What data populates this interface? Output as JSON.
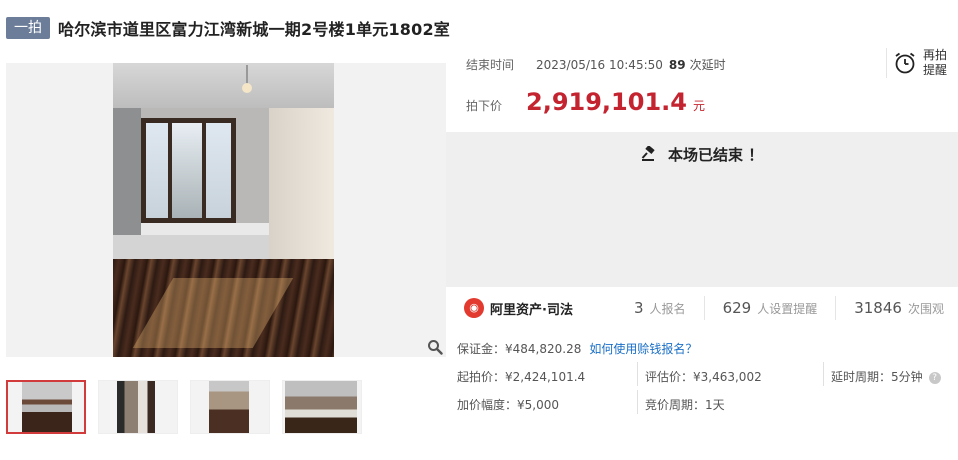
{
  "title": {
    "badge": "一拍",
    "text": "哈尔滨市道里区富力江湾新城一期2号楼1单元1802室"
  },
  "auction": {
    "end_time_label": "结束时间",
    "end_time_value": "2023/05/16 10:45:50",
    "delay_count": "89",
    "delay_unit": "次延时",
    "price_label": "拍下价",
    "price_value": "2,919,101.4",
    "price_unit": "元",
    "remind_label": "再拍提醒",
    "status": "本场已结束 ！"
  },
  "stats": {
    "brand": "阿里资产·司法",
    "signups": "3",
    "signups_label": "人报名",
    "reminders": "629",
    "reminders_label": "人设置提醒",
    "views": "31846",
    "views_label": "次围观"
  },
  "details": {
    "deposit": "保证金：¥484,820.28",
    "deposit_link": "如何使用赊钱报名？",
    "start_price": "起拍价：¥2,424,101.4",
    "eval_price": "评估价：¥3,463,002",
    "delay_period": "延时周期：5分钟",
    "increment": "加价幅度：¥5,000",
    "bid_period": "竞价周期：1天"
  },
  "colors": {
    "price_red": "#c4242f",
    "link_blue": "#1a6fc7",
    "badge_bg": "#6b7d99",
    "thumb_active": "#d23b3b"
  }
}
